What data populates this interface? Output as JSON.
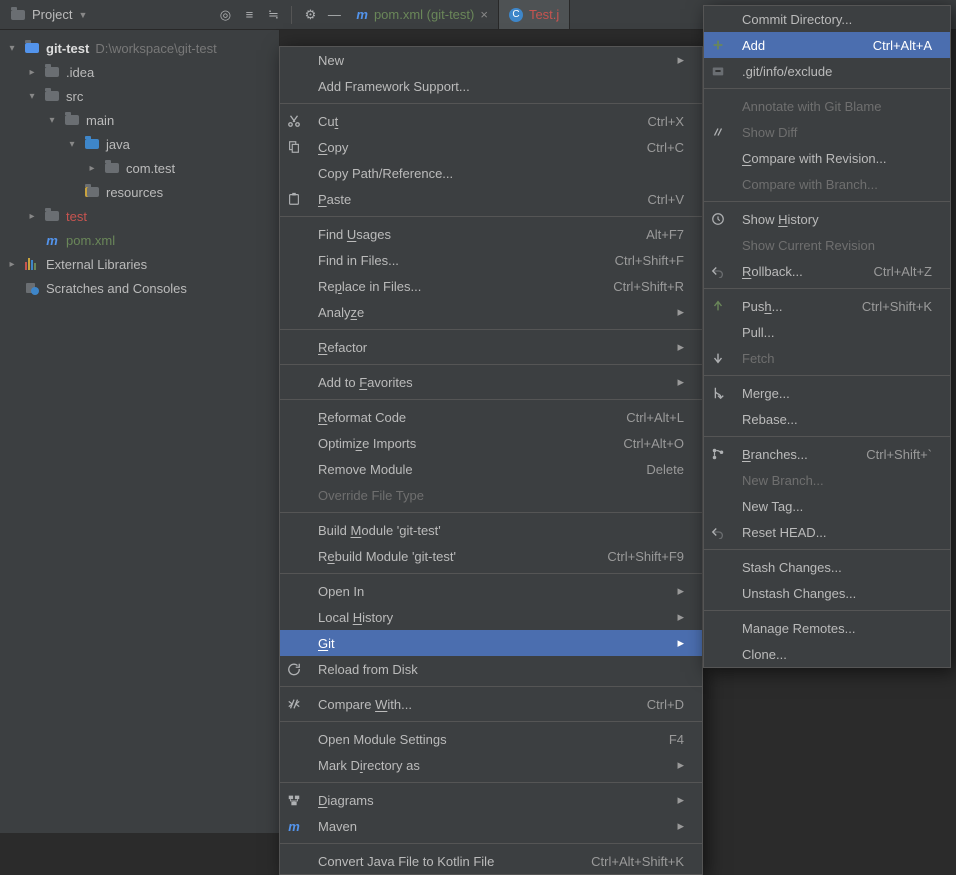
{
  "toolbar": {
    "project_label": "Project",
    "tabs": [
      {
        "label": "pom.xml (git-test)",
        "active": false
      },
      {
        "label": "Test.j",
        "active": true
      }
    ]
  },
  "tree": {
    "root": {
      "name": "git-test",
      "path": "D:\\workspace\\git-test"
    },
    "nodes": [
      {
        "indent": 1,
        "arrow": "right",
        "icon": "folder",
        "label": ".idea"
      },
      {
        "indent": 1,
        "arrow": "down",
        "icon": "folder",
        "label": "src"
      },
      {
        "indent": 2,
        "arrow": "down",
        "icon": "folder",
        "label": "main"
      },
      {
        "indent": 3,
        "arrow": "down",
        "icon": "folder-src",
        "label": "java"
      },
      {
        "indent": 4,
        "arrow": "right",
        "icon": "folder",
        "label": "com.test"
      },
      {
        "indent": 3,
        "arrow": "",
        "icon": "folder-res",
        "label": "resources"
      },
      {
        "indent": 1,
        "arrow": "right",
        "icon": "folder",
        "label": "test",
        "label_color": "red"
      },
      {
        "indent": 1,
        "arrow": "",
        "icon": "m",
        "label": "pom.xml",
        "label_color": "green"
      }
    ],
    "ext_libs": "External Libraries",
    "scratches": "Scratches and Consoles"
  },
  "menu1": [
    {
      "label": "New",
      "arrow": true
    },
    {
      "label": "Add Framework Support..."
    },
    {
      "sep": true
    },
    {
      "icon": "cut",
      "label": "Cut",
      "mn": "t",
      "shortcut": "Ctrl+X"
    },
    {
      "icon": "copy",
      "label": "Copy",
      "mn": "C",
      "shortcut": "Ctrl+C"
    },
    {
      "label": "Copy Path/Reference..."
    },
    {
      "icon": "paste",
      "label": "Paste",
      "mn": "P",
      "shortcut": "Ctrl+V"
    },
    {
      "sep": true
    },
    {
      "label": "Find Usages",
      "mn": "U",
      "shortcut": "Alt+F7"
    },
    {
      "label": "Find in Files...",
      "shortcut": "Ctrl+Shift+F"
    },
    {
      "label": "Replace in Files...",
      "mn": "p",
      "shortcut": "Ctrl+Shift+R"
    },
    {
      "label": "Analyze",
      "mn": "z",
      "arrow": true
    },
    {
      "sep": true
    },
    {
      "label": "Refactor",
      "mn": "R",
      "arrow": true
    },
    {
      "sep": true
    },
    {
      "label": "Add to Favorites",
      "mn": "F",
      "arrow": true
    },
    {
      "sep": true
    },
    {
      "label": "Reformat Code",
      "mn": "R",
      "shortcut": "Ctrl+Alt+L"
    },
    {
      "label": "Optimize Imports",
      "mn": "z",
      "shortcut": "Ctrl+Alt+O"
    },
    {
      "label": "Remove Module",
      "shortcut": "Delete"
    },
    {
      "label": "Override File Type",
      "disabled": true
    },
    {
      "sep": true
    },
    {
      "label": "Build Module 'git-test'",
      "mn": "M"
    },
    {
      "label": "Rebuild Module 'git-test'",
      "mn": "e",
      "shortcut": "Ctrl+Shift+F9"
    },
    {
      "sep": true
    },
    {
      "label": "Open In",
      "arrow": true
    },
    {
      "label": "Local History",
      "mn": "H",
      "arrow": true
    },
    {
      "icon": "git",
      "label": "Git",
      "mn": "G",
      "arrow": true,
      "hover": true
    },
    {
      "icon": "reload",
      "label": "Reload from Disk"
    },
    {
      "sep": true
    },
    {
      "icon": "compare",
      "label": "Compare With...",
      "mn": "W",
      "shortcut": "Ctrl+D"
    },
    {
      "sep": true
    },
    {
      "label": "Open Module Settings",
      "shortcut": "F4"
    },
    {
      "label": "Mark Directory as",
      "mn": "i",
      "arrow": true
    },
    {
      "sep": true
    },
    {
      "icon": "diagram",
      "label": "Diagrams",
      "mn": "D",
      "arrow": true
    },
    {
      "icon": "m",
      "label": "Maven",
      "arrow": true
    },
    {
      "sep": true
    },
    {
      "label": "Convert Java File to Kotlin File",
      "shortcut": "Ctrl+Alt+Shift+K"
    }
  ],
  "menu2": [
    {
      "label": "Commit Directory..."
    },
    {
      "icon": "add",
      "label": "Add",
      "hover": true,
      "shortcut": "Ctrl+Alt+A"
    },
    {
      "icon": "exclude",
      "label": ".git/info/exclude"
    },
    {
      "sep": true
    },
    {
      "label": "Annotate with Git Blame",
      "disabled": true
    },
    {
      "icon": "diff",
      "label": "Show Diff",
      "disabled": true
    },
    {
      "label": "Compare with Revision...",
      "mn": "C"
    },
    {
      "label": "Compare with Branch...",
      "disabled": true
    },
    {
      "sep": true
    },
    {
      "icon": "history",
      "label": "Show History",
      "mn": "H"
    },
    {
      "label": "Show Current Revision",
      "disabled": true
    },
    {
      "icon": "rollback",
      "label": "Rollback...",
      "mn": "R",
      "shortcut": "Ctrl+Alt+Z"
    },
    {
      "sep": true
    },
    {
      "icon": "push",
      "label": "Push...",
      "mn": "h",
      "shortcut": "Ctrl+Shift+K"
    },
    {
      "label": "Pull..."
    },
    {
      "icon": "fetch",
      "label": "Fetch",
      "disabled": true
    },
    {
      "sep": true
    },
    {
      "icon": "merge",
      "label": "Merge..."
    },
    {
      "label": "Rebase..."
    },
    {
      "sep": true
    },
    {
      "icon": "branch",
      "label": "Branches...",
      "mn": "B",
      "shortcut": "Ctrl+Shift+`"
    },
    {
      "label": "New Branch...",
      "disabled": true
    },
    {
      "label": "New Tag..."
    },
    {
      "icon": "rollback",
      "label": "Reset HEAD..."
    },
    {
      "sep": true
    },
    {
      "label": "Stash Changes..."
    },
    {
      "label": "Unstash Changes..."
    },
    {
      "sep": true
    },
    {
      "label": "Manage Remotes..."
    },
    {
      "label": "Clone..."
    }
  ]
}
